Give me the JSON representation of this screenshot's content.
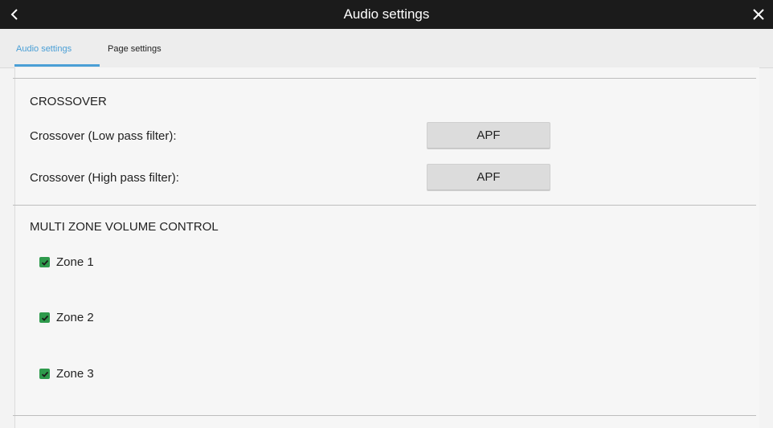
{
  "header": {
    "title": "Audio settings"
  },
  "tabs": [
    {
      "label": "Audio settings"
    },
    {
      "label": "Page settings"
    }
  ],
  "crossover": {
    "heading": "CROSSOVER",
    "low_label": "Crossover (Low pass filter):",
    "low_value": "APF",
    "high_label": "Crossover (High pass filter):",
    "high_value": "APF"
  },
  "multizone": {
    "heading": "MULTI ZONE VOLUME CONTROL",
    "zones": [
      {
        "label": "Zone 1",
        "checked": true
      },
      {
        "label": "Zone 2",
        "checked": true
      },
      {
        "label": "Zone 3",
        "checked": true
      }
    ]
  },
  "colors": {
    "titlebar": "#1b1b1b",
    "accent": "#4a9fd6",
    "checkbox": "#2e9a4c"
  },
  "icons": [
    "back-arrow-icon",
    "close-icon",
    "checkmark-icon"
  ]
}
